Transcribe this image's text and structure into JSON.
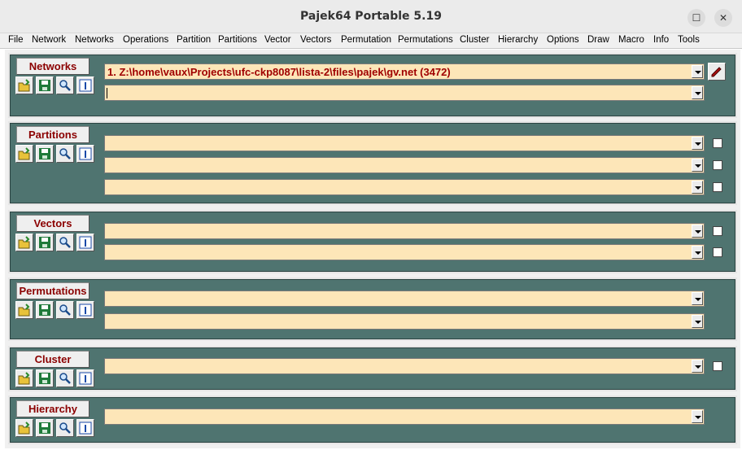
{
  "window": {
    "title": "Pajek64 Portable 5.19",
    "maximize_glyph": "☐",
    "close_glyph": "✕"
  },
  "menu": [
    "File",
    "Network",
    "Networks",
    "Operations",
    "Partition",
    "Partitions",
    "Vector",
    "Vectors",
    "Permutation",
    "Permutations",
    "Cluster",
    "Hierarchy",
    "Options",
    "Draw",
    "Macro",
    "Info",
    "Tools"
  ],
  "panels": {
    "networks": {
      "label": "Networks",
      "rows": [
        "1. Z:\\home\\vaux\\Projects\\ufc-ckp8087\\lista-2\\files\\pajek\\gv.net (3472)",
        ""
      ]
    },
    "partitions": {
      "label": "Partitions",
      "rows": [
        "",
        "",
        ""
      ]
    },
    "vectors": {
      "label": "Vectors",
      "rows": [
        "",
        ""
      ]
    },
    "permutations": {
      "label": "Permutations",
      "rows": [
        "",
        ""
      ]
    },
    "cluster": {
      "label": "Cluster",
      "rows": [
        ""
      ]
    },
    "hierarchy": {
      "label": "Hierarchy",
      "rows": [
        ""
      ]
    }
  },
  "icons": [
    "open-icon",
    "save-icon",
    "view-icon",
    "info-icon",
    "edit-icon"
  ],
  "colors": {
    "panel_bg": "#4f7470",
    "combo_bg": "#fde6b8",
    "label_text": "#8b0000"
  }
}
